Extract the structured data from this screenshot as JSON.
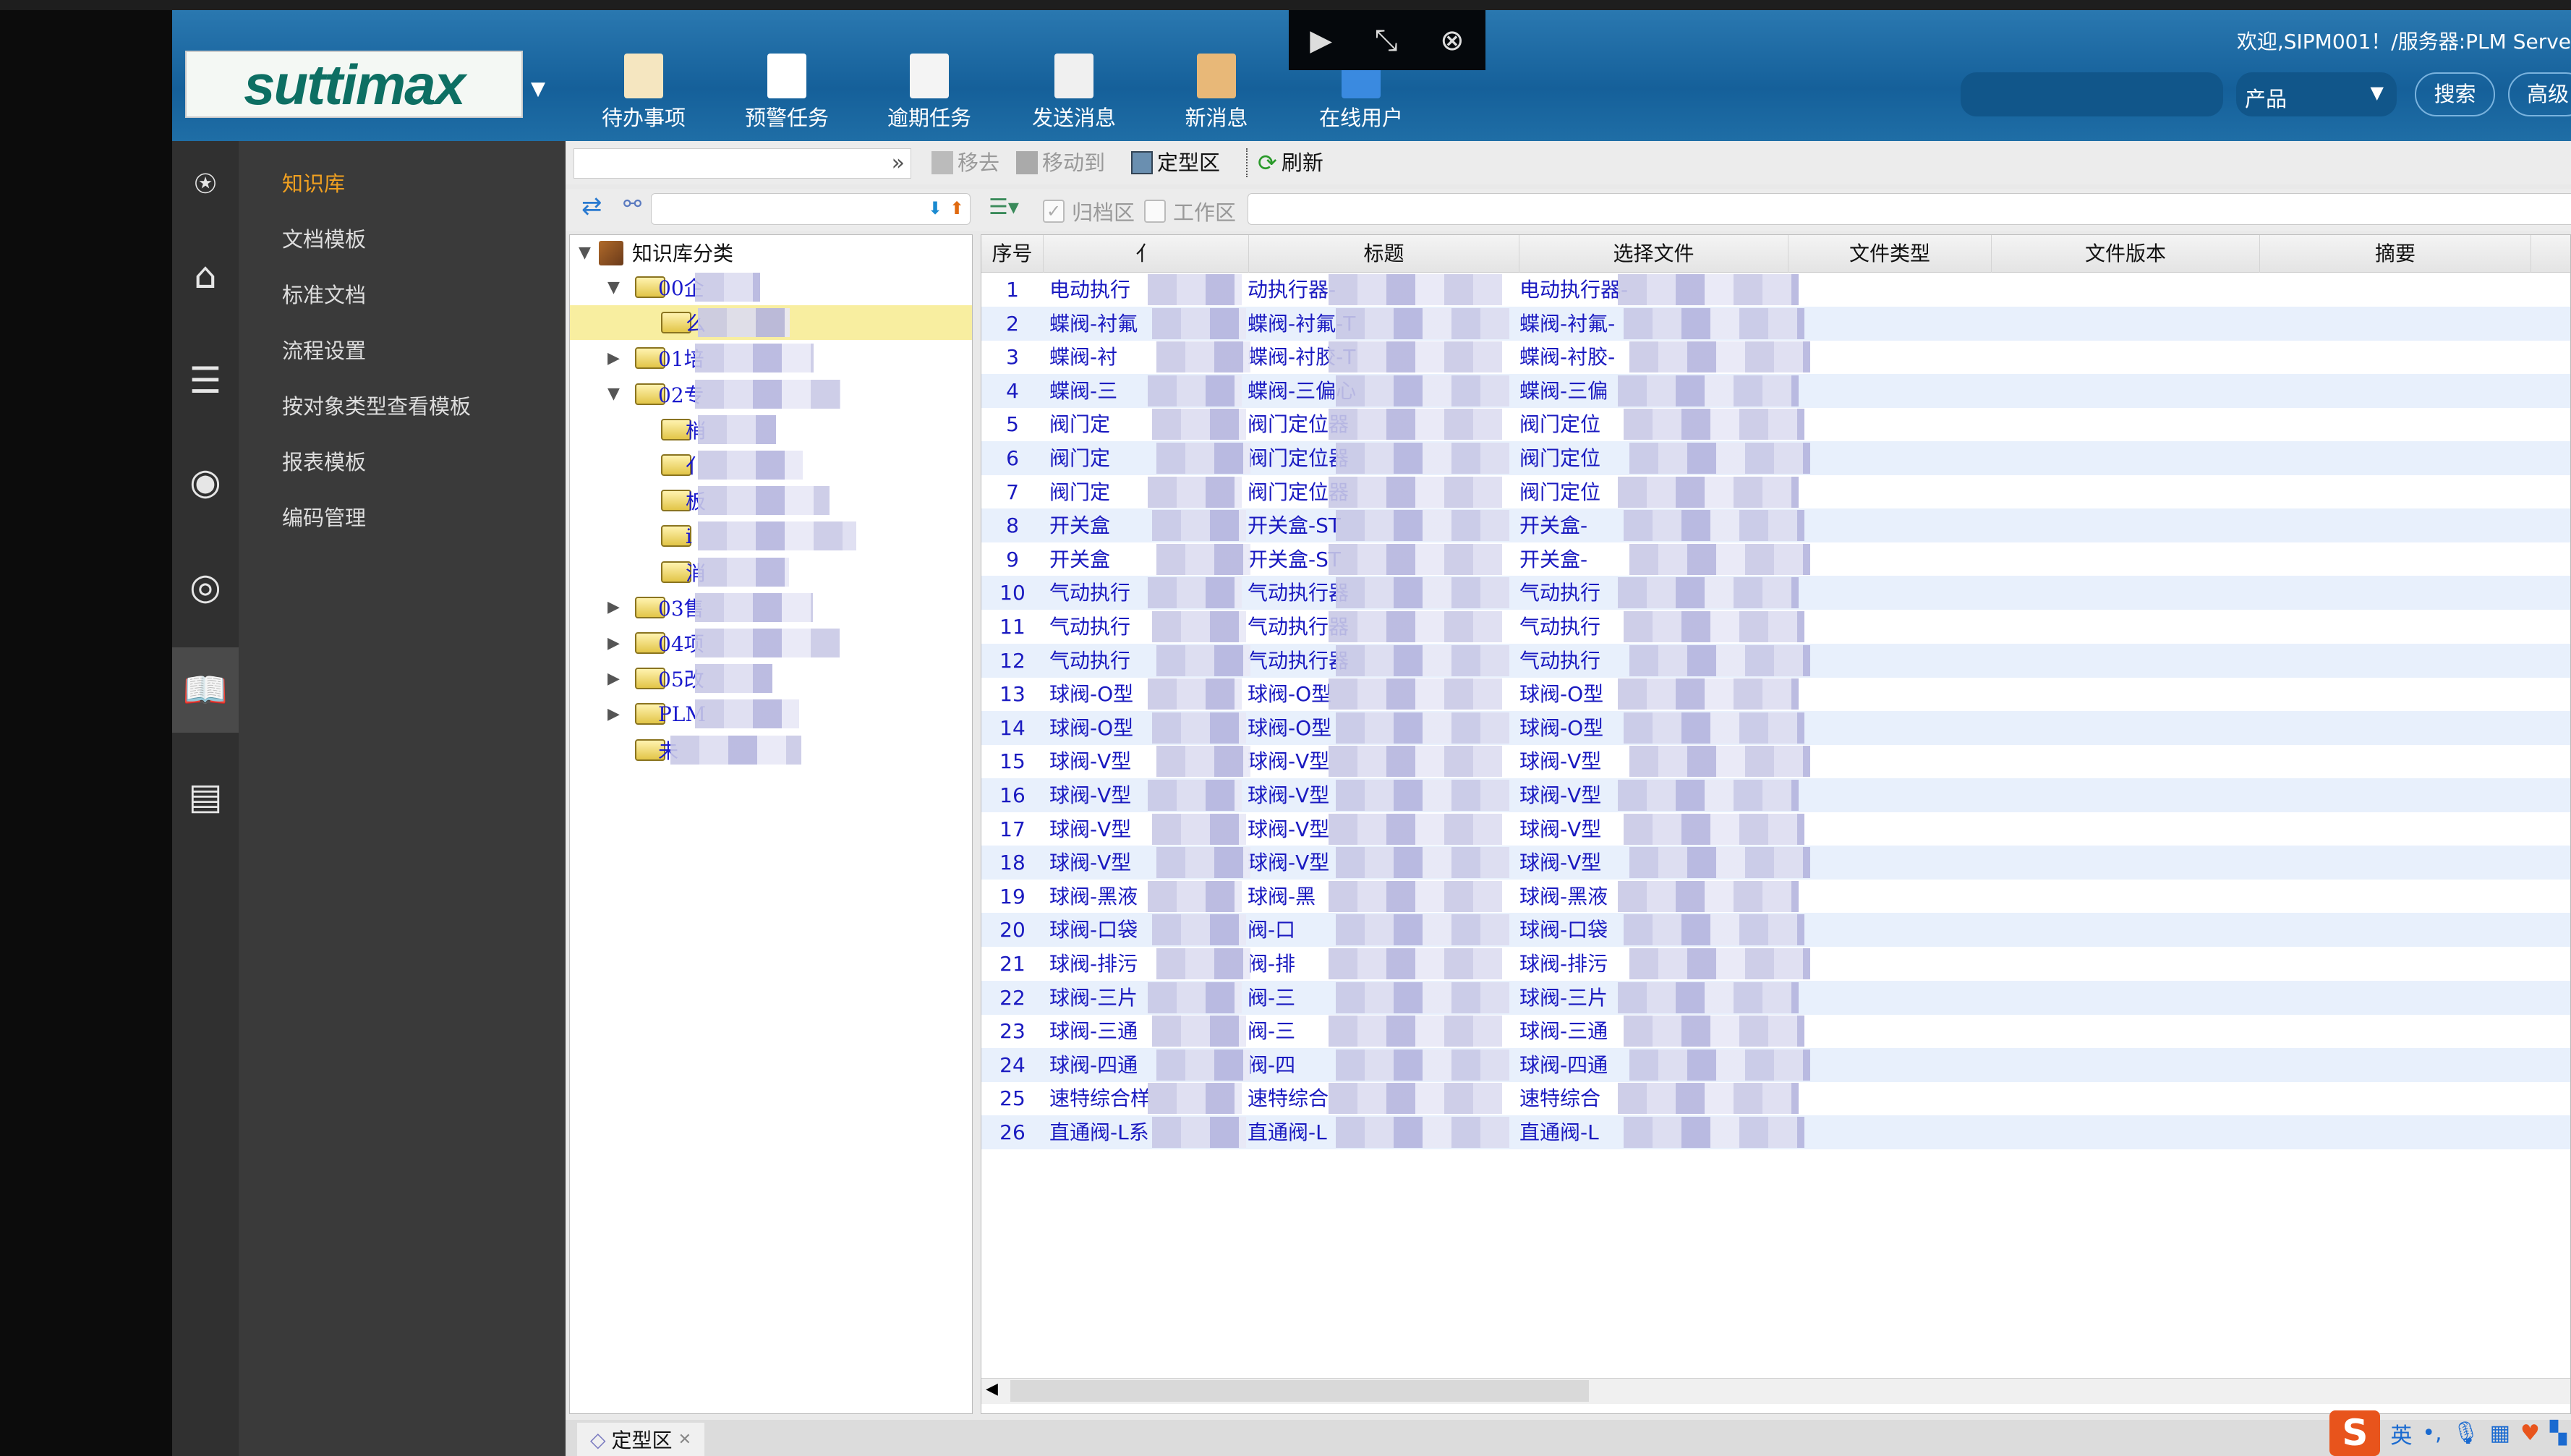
{
  "header": {
    "logo": "suttimax",
    "buttons": [
      {
        "label": "待办事项",
        "icon": "todo-icon"
      },
      {
        "label": "预警任务",
        "icon": "warning-task-icon"
      },
      {
        "label": "逾期任务",
        "icon": "overdue-task-icon"
      },
      {
        "label": "发送消息",
        "icon": "send-message-icon"
      },
      {
        "label": "新消息",
        "icon": "new-message-icon"
      },
      {
        "label": "在线用户",
        "icon": "online-users-icon"
      }
    ],
    "welcome": "欢迎,SIPM001！/服务器:PLM Serve",
    "search_value": "",
    "search_scope": "产品",
    "search_label": "搜索",
    "advanced_label": "高级"
  },
  "sidebar_icons": [
    "sipm-search-icon",
    "home-icon",
    "database-icon",
    "chat-icon",
    "broadcast-icon",
    "book-icon",
    "id-card-icon"
  ],
  "nav": {
    "items": [
      "知识库",
      "文档模板",
      "标准文档",
      "流程设置",
      "按对象类型查看模板",
      "报表模板",
      "编码管理"
    ],
    "active": 0
  },
  "toolbar": {
    "move_out": "移去",
    "move_to": "移动到",
    "finalized": "定型区",
    "refresh": "刷新"
  },
  "filter": {
    "archive_label": "归档区",
    "archive_checked": true,
    "work_label": "工作区",
    "work_checked": false
  },
  "tree": {
    "root": "知识库分类",
    "nodes": [
      {
        "label": "00企",
        "level": 1,
        "toggle": "expanded"
      },
      {
        "label": "么",
        "level": 2,
        "toggle": "none",
        "selected": true
      },
      {
        "label": "01培",
        "level": 1,
        "toggle": "collapsed"
      },
      {
        "label": "02专",
        "level": 1,
        "toggle": "expanded"
      },
      {
        "label": "梢",
        "level": 2,
        "toggle": "none"
      },
      {
        "label": "亻",
        "level": 2,
        "toggle": "none"
      },
      {
        "label": "板",
        "level": 2,
        "toggle": "none"
      },
      {
        "label": "i",
        "level": 2,
        "toggle": "none"
      },
      {
        "label": "消",
        "level": 2,
        "toggle": "none"
      },
      {
        "label": "03售",
        "level": 1,
        "toggle": "collapsed"
      },
      {
        "label": "04项",
        "level": 1,
        "toggle": "collapsed"
      },
      {
        "label": "05改",
        "level": 1,
        "toggle": "collapsed"
      },
      {
        "label": "PLM",
        "level": 1,
        "toggle": "collapsed"
      },
      {
        "label": "未",
        "level": 1,
        "toggle": "none"
      }
    ]
  },
  "grid": {
    "columns": [
      "序号",
      "亻",
      "标题",
      "选择文件",
      "文件类型",
      "文件版本",
      "摘要"
    ],
    "rows": [
      [
        "1",
        "电动执行",
        "动执行器-",
        "电动执行器-"
      ],
      [
        "2",
        "蝶阀-衬氟",
        "蝶阀-衬氟-T",
        "蝶阀-衬氟-"
      ],
      [
        "3",
        "蝶阀-衬",
        "蝶阀-衬胶-T",
        "蝶阀-衬胶-"
      ],
      [
        "4",
        "蝶阀-三",
        "蝶阀-三偏心",
        "蝶阀-三偏"
      ],
      [
        "5",
        "阀门定",
        "阀门定位器",
        "阀门定位"
      ],
      [
        "6",
        "阀门定",
        "阀门定位器",
        "阀门定位"
      ],
      [
        "7",
        "阀门定",
        "阀门定位器",
        "阀门定位"
      ],
      [
        "8",
        "开关盒",
        "开关盒-ST",
        "开关盒-"
      ],
      [
        "9",
        "开关盒",
        "开关盒-ST",
        "开关盒-"
      ],
      [
        "10",
        "气动执行",
        "气动执行器",
        "气动执行"
      ],
      [
        "11",
        "气动执行",
        "气动执行器",
        "气动执行"
      ],
      [
        "12",
        "气动执行",
        "气动执行器",
        "气动执行"
      ],
      [
        "13",
        "球阀-O型",
        "球阀-O型",
        "球阀-O型"
      ],
      [
        "14",
        "球阀-O型",
        "球阀-O型",
        "球阀-O型"
      ],
      [
        "15",
        "球阀-V型",
        "球阀-V型",
        "球阀-V型"
      ],
      [
        "16",
        "球阀-V型",
        "球阀-V型",
        "球阀-V型"
      ],
      [
        "17",
        "球阀-V型",
        "球阀-V型",
        "球阀-V型"
      ],
      [
        "18",
        "球阀-V型",
        "球阀-V型",
        "球阀-V型"
      ],
      [
        "19",
        "球阀-黑液",
        "球阀-黑",
        "球阀-黑液"
      ],
      [
        "20",
        "球阀-口袋",
        "阀-口",
        "球阀-口袋"
      ],
      [
        "21",
        "球阀-排污",
        "阀-排",
        "球阀-排污"
      ],
      [
        "22",
        "球阀-三片",
        "阀-三",
        "球阀-三片"
      ],
      [
        "23",
        "球阀-三通",
        "阀-三",
        "球阀-三通"
      ],
      [
        "24",
        "球阀-四通",
        "阀-四",
        "球阀-四通"
      ],
      [
        "25",
        "速特综合样",
        "速特综合",
        "速特综合"
      ],
      [
        "26",
        "直通阀-L系",
        "直通阀-L",
        "直通阀-L"
      ]
    ]
  },
  "bottom_tab": "定型区",
  "ime": {
    "lang": "英",
    "punct": "•,"
  }
}
